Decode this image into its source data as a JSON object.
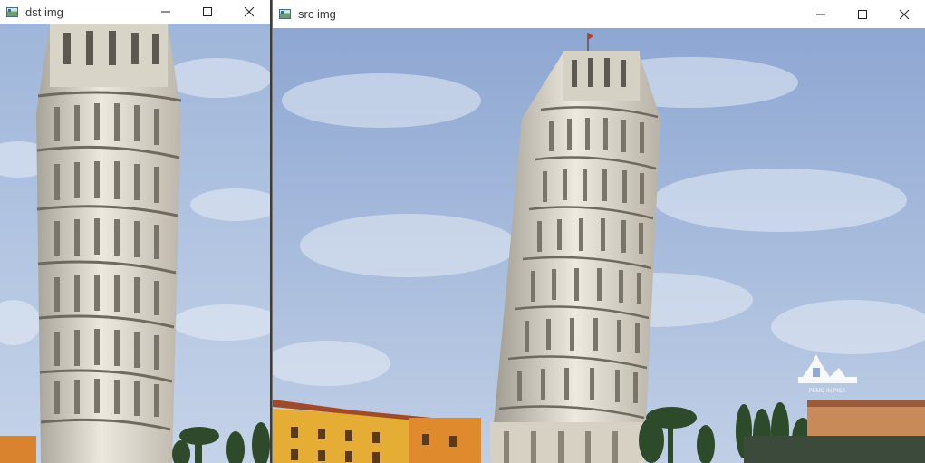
{
  "windows": {
    "dst": {
      "title": "dst img",
      "icon": "window-app-icon"
    },
    "src": {
      "title": "src img",
      "icon": "window-app-icon"
    }
  },
  "controls": {
    "minimize": "minimize-icon",
    "maximize": "maximize-icon",
    "close": "close-icon"
  },
  "image_content": {
    "subject": "Leaning Tower of Pisa against cloudy sky",
    "watermark": "PEMO IN PISA"
  },
  "colors": {
    "sky": "#8fa9d2",
    "tower": "#e6e2d8",
    "buildings": "#e6b13a"
  }
}
